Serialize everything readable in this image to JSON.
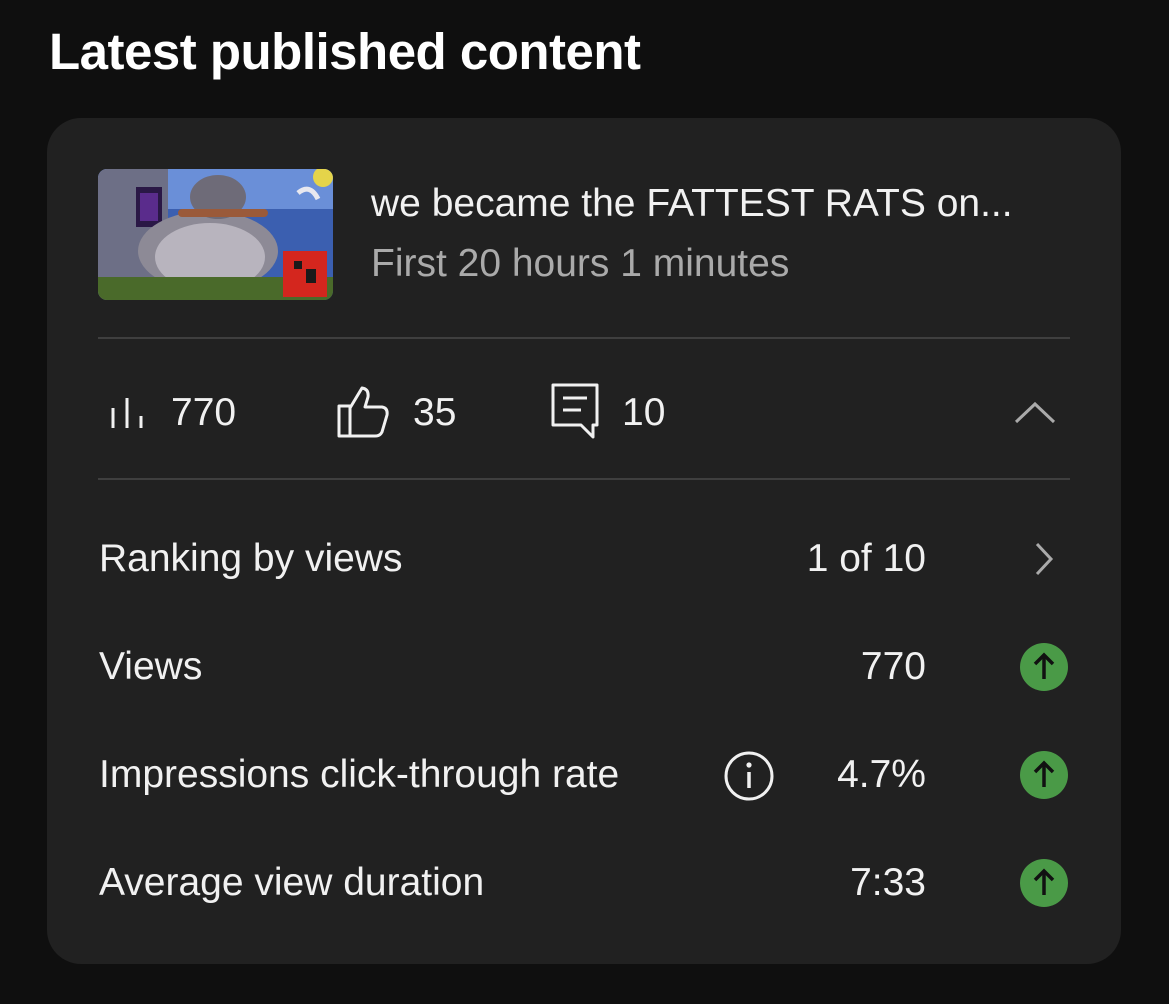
{
  "page": {
    "title": "Latest published content"
  },
  "video": {
    "title": "we became the FATTEST RATS on...",
    "subtitle": "First 20 hours 1 minutes",
    "thumbnail_icon": "video-thumbnail"
  },
  "stats": {
    "views": "770",
    "likes": "35",
    "comments": "10"
  },
  "metrics": {
    "ranking": {
      "label": "Ranking by views",
      "value": "1 of 10"
    },
    "views": {
      "label": "Views",
      "value": "770",
      "trend": "up"
    },
    "ctr": {
      "label": "Impressions click-through rate",
      "value": "4.7%",
      "trend": "up"
    },
    "avd": {
      "label": "Average view duration",
      "value": "7:33",
      "trend": "up"
    }
  },
  "colors": {
    "background": "#0f0f0f",
    "card": "#212121",
    "trend_up": "#4a9a47",
    "muted_text": "#aaaaaa"
  }
}
